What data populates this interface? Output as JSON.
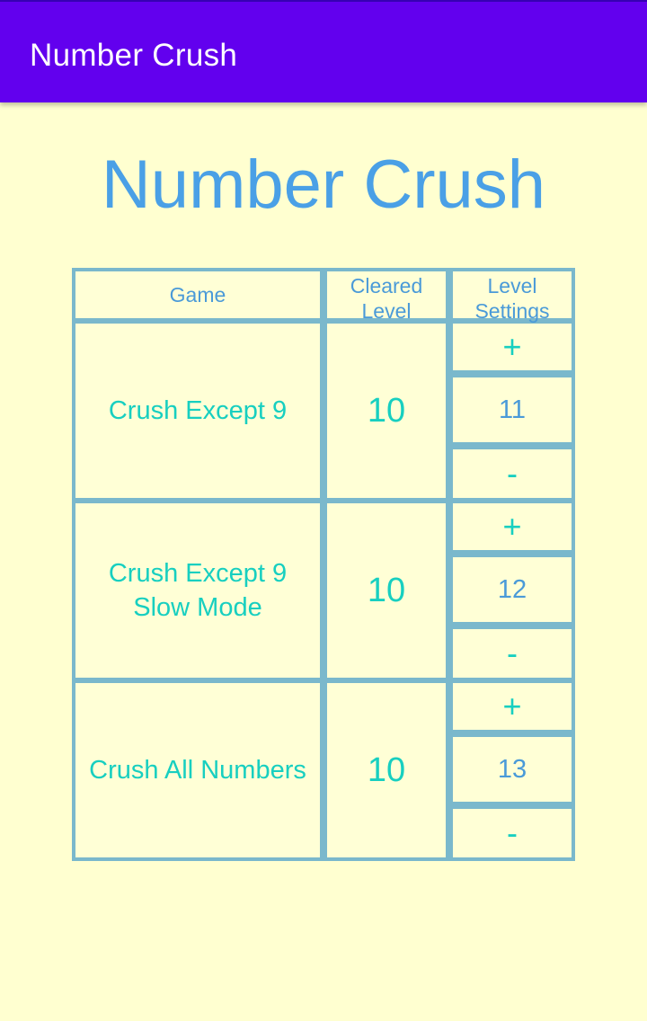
{
  "app_bar": {
    "title": "Number Crush"
  },
  "headline": "Number Crush",
  "table": {
    "headers": {
      "game": "Game",
      "cleared": "Cleared\nLevel",
      "settings": "Level\nSettings"
    },
    "rows": [
      {
        "game": "Crush Except 9",
        "cleared": "10",
        "setting_value": "11",
        "plus": "+",
        "minus": "-"
      },
      {
        "game": "Crush Except 9\nSlow Mode",
        "cleared": "10",
        "setting_value": "12",
        "plus": "+",
        "minus": "-"
      },
      {
        "game": "Crush All Numbers",
        "cleared": "10",
        "setting_value": "13",
        "plus": "+",
        "minus": "-"
      }
    ]
  },
  "colors": {
    "app_bar": "#6200ee",
    "background": "#ffffd0",
    "grid": "#7ab8cc",
    "headline": "#4aa0e6",
    "accent_teal": "#17cfc0",
    "value_blue": "#4a9ad8"
  }
}
